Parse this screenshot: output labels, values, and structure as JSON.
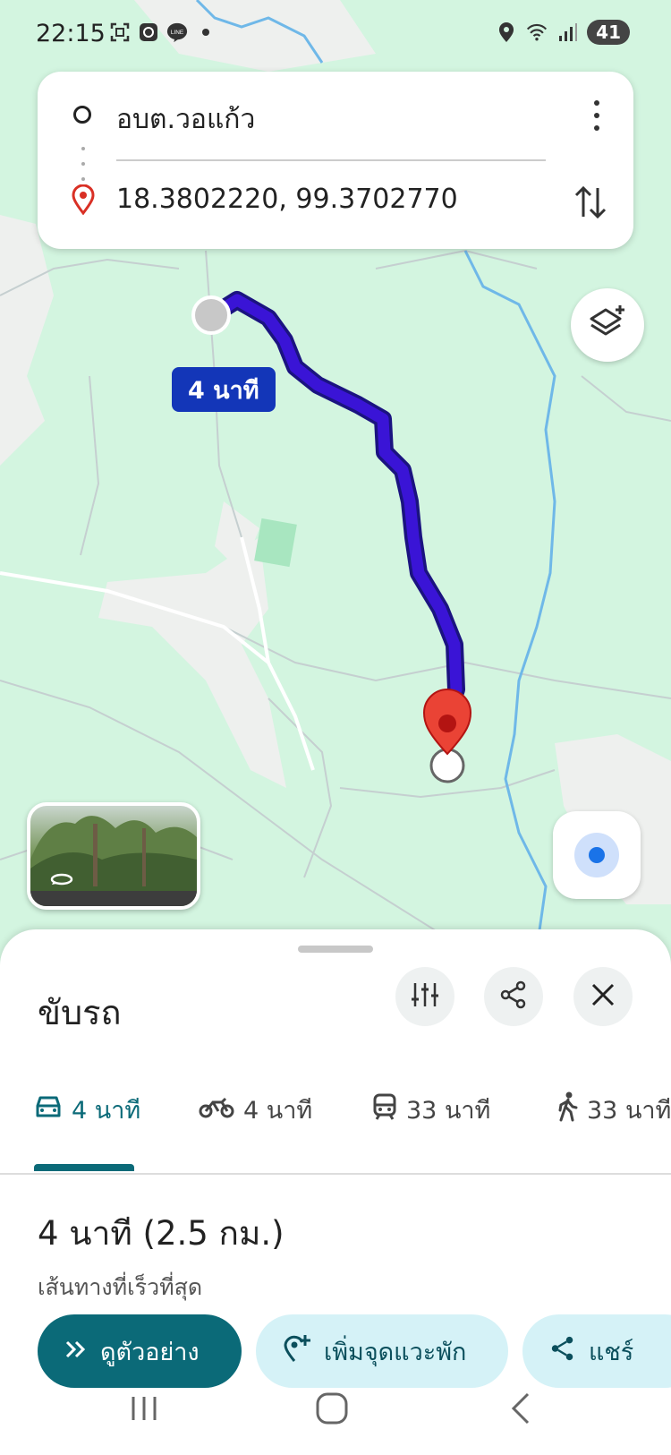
{
  "status_bar": {
    "time": "22:15",
    "battery": "41",
    "icons_left": [
      "screenshot-icon",
      "camera-app-icon",
      "line-icon",
      "dot-icon"
    ],
    "icons_right": [
      "location-icon",
      "wifi-icon",
      "signal-icon"
    ]
  },
  "directions": {
    "origin": "อบต.วอแก้ว",
    "destination": "18.3802220, 99.3702770"
  },
  "map": {
    "route_time_label": "4 นาที",
    "route_color": "#3a14d6",
    "land_color": "#d3f5e0"
  },
  "sheet": {
    "title": "ขับรถ",
    "modes": [
      {
        "icon": "car-icon",
        "label": "4 นาที",
        "active": true
      },
      {
        "icon": "motorcycle-icon",
        "label": "4 นาที",
        "active": false
      },
      {
        "icon": "transit-icon",
        "label": "33 นาที",
        "active": false
      },
      {
        "icon": "walk-icon",
        "label": "33 นาที",
        "active": false
      }
    ],
    "summary": "4 นาที (2.5 กม.)",
    "subtitle": "เส้นทางที่เร็วที่สุด",
    "buttons": {
      "preview": "ดูตัวอย่าง",
      "add_stop": "เพิ่มจุดแวะพัก",
      "share": "แชร์"
    },
    "accent_color": "#0b6a78"
  }
}
